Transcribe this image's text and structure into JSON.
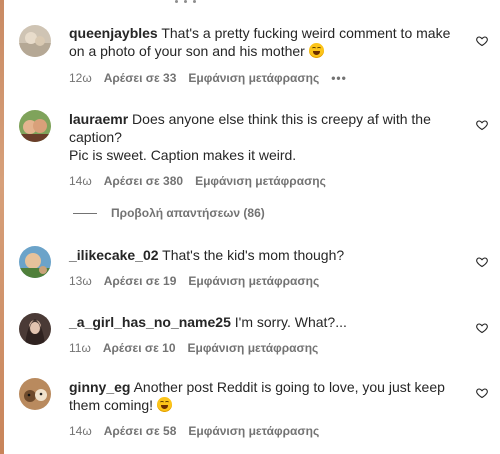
{
  "comments": [
    {
      "username": "queenjaybles",
      "text": "That's a pretty fucking weird comment to make on a photo of your son and his mother",
      "emoji": "grinning-sweat-emoji",
      "time": "12ω",
      "likes": "Αρέσει σε 33",
      "translate": "Εμφάνιση μετάφρασης",
      "more": "•••"
    },
    {
      "username": "lauraemr",
      "text": "Does anyone else think this is creepy af with the caption?",
      "text2": "Pic is sweet. Caption makes it weird.",
      "time": "14ω",
      "likes": "Αρέσει σε 380",
      "translate": "Εμφάνιση μετάφρασης",
      "view_replies": "Προβολή απαντήσεων (86)"
    },
    {
      "username": "_ilikecake_02",
      "text": "That's the kid's mom though?",
      "time": "13ω",
      "likes": "Αρέσει σε 19",
      "translate": "Εμφάνιση μετάφρασης"
    },
    {
      "username": "_a_girl_has_no_name25",
      "text": "I'm sorry. What?...",
      "time": "11ω",
      "likes": "Αρέσει σε 10",
      "translate": "Εμφάνιση μετάφρασης"
    },
    {
      "username": "ginny_eg",
      "text": "Another post Reddit is going to love, you just keep them coming!",
      "emoji": "grinning-sweat-emoji",
      "time": "14ω",
      "likes": "Αρέσει σε 58",
      "translate": "Εμφάνιση μετάφρασης"
    }
  ],
  "colors": {
    "text_primary": "#262626",
    "text_secondary": "#737373",
    "background": "#ffffff"
  }
}
